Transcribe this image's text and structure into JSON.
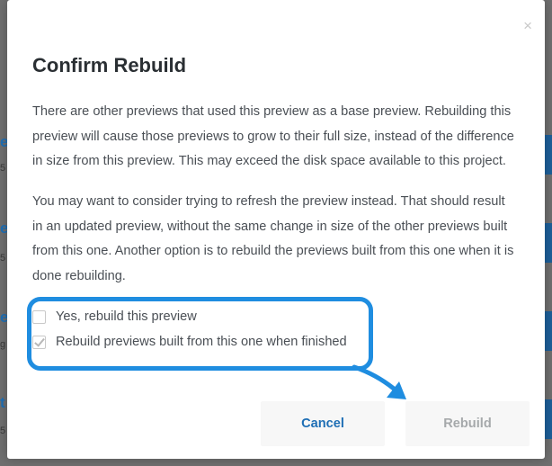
{
  "modal": {
    "title": "Confirm Rebuild",
    "close_icon": "×",
    "paragraphs": [
      "There are other previews that used this preview as a base preview. Rebuilding this preview will cause those previews to grow to their full size, instead of the difference in size from this preview. This may exceed the disk space available to this project.",
      "You may want to consider trying to refresh the preview instead. That should result in an updated preview, without the same change in size of the other previews built from this one. Another option is to rebuild the previews built from this one when it is done rebuilding."
    ],
    "options": [
      {
        "label": "Yes, rebuild this preview",
        "checked": false
      },
      {
        "label": "Rebuild previews built from this one when finished",
        "checked": true
      }
    ],
    "buttons": {
      "cancel": "Cancel",
      "rebuild": "Rebuild"
    }
  },
  "colors": {
    "accent": "#1f6fb5",
    "highlight": "#1f8de0",
    "disabled_text": "#a6a9ab"
  },
  "icons": {
    "close": "close-icon",
    "annotation": "arrow-annotation-icon"
  }
}
